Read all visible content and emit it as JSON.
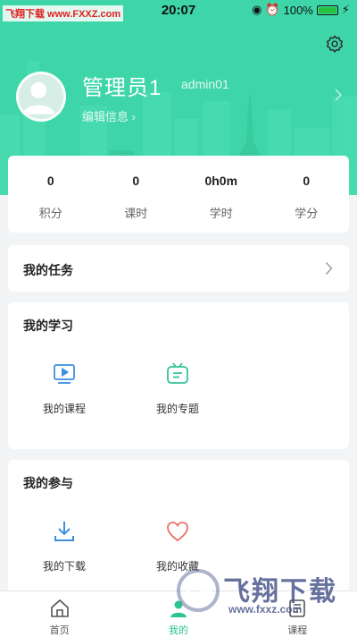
{
  "statusbar": {
    "time": "20:07",
    "battery": "100%"
  },
  "watermark_top": "飞翔下载 www.FXXZ.com",
  "profile": {
    "name": "管理员1",
    "id": "admin01",
    "edit": "编辑信息"
  },
  "stats": [
    {
      "value": "0",
      "label": "积分"
    },
    {
      "value": "0",
      "label": "课时"
    },
    {
      "value": "0h0m",
      "label": "学时"
    },
    {
      "value": "0",
      "label": "学分"
    }
  ],
  "tasks": {
    "title": "我的任务"
  },
  "study": {
    "title": "我的学习",
    "items": [
      {
        "label": "我的课程",
        "icon": "video-course-icon"
      },
      {
        "label": "我的专题",
        "icon": "topic-icon"
      }
    ]
  },
  "join": {
    "title": "我的参与",
    "items": [
      {
        "label": "我的下载",
        "icon": "download-icon"
      },
      {
        "label": "我的收藏",
        "icon": "heart-icon"
      }
    ]
  },
  "tabs": [
    {
      "label": "首页",
      "icon": "home-icon",
      "active": false
    },
    {
      "label": "我的",
      "icon": "profile-icon",
      "active": true
    },
    {
      "label": "课程",
      "icon": "course-icon",
      "active": false
    }
  ],
  "watermark": {
    "text": "飞翔下载",
    "url": "www.fxxz.com"
  },
  "colors": {
    "accent": "#3ed6a8",
    "active_tab": "#2bc391",
    "icon_blue": "#3a8fe0",
    "icon_green": "#33c39a",
    "icon_red": "#e8736a"
  }
}
